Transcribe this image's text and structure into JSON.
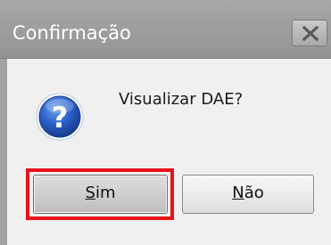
{
  "dialog": {
    "title": "Confirmação",
    "message": "Visualizar DAE?",
    "icon": "question-icon"
  },
  "buttons": {
    "yes": {
      "mnemonic": "S",
      "rest": "im"
    },
    "no": {
      "mnemonic": "N",
      "rest": "ão"
    }
  },
  "colors": {
    "titlebar": "#9d9d9d",
    "highlight": "#e8121b",
    "icon_blue": "#1f4fb3"
  }
}
